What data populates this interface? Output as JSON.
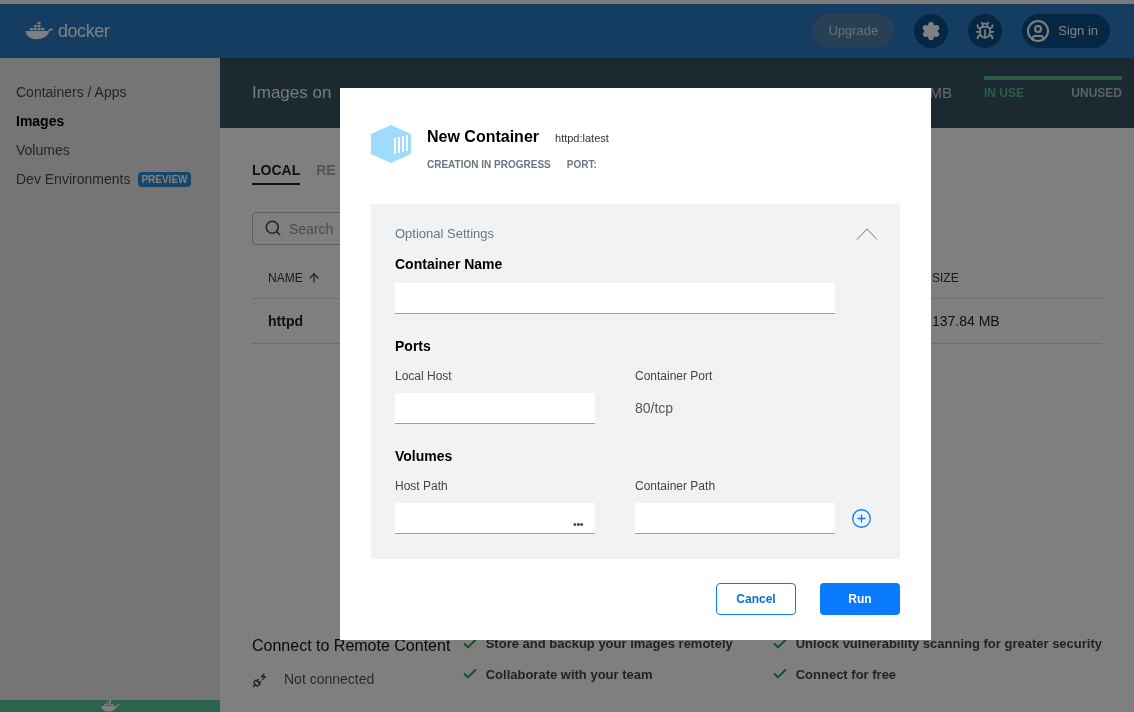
{
  "header": {
    "logo": "docker",
    "buttons": [
      {
        "kind": "upgrade",
        "label": "Upgrade"
      },
      {
        "kind": "settings"
      },
      {
        "kind": "troubleshoot"
      },
      {
        "kind": "signin",
        "label": "Sign in"
      }
    ]
  },
  "sidebar": {
    "items": [
      {
        "label": "Containers / Apps",
        "selected": false
      },
      {
        "label": "Images",
        "selected": true
      },
      {
        "label": "Volumes",
        "selected": false
      },
      {
        "label": "Dev Environments",
        "selected": false,
        "badge": "PREVIEW"
      }
    ]
  },
  "banner": {
    "title": "Images on",
    "size": "MB",
    "usage": {
      "level": 1,
      "in_use": "IN USE",
      "unused": "UNUSED"
    }
  },
  "tabs": [
    {
      "label": "LOCAL",
      "selected": true
    },
    {
      "label": "RE",
      "selected": false
    }
  ],
  "search": {
    "placeholder": "Search"
  },
  "table": {
    "columns": [
      {
        "label": "NAME",
        "sorted": true
      },
      {
        "label": "SIZE",
        "sorted": false
      }
    ],
    "rows": [
      {
        "name": "httpd",
        "size": "137.84 MB"
      }
    ]
  },
  "remote": {
    "title": "Connect to Remote Content",
    "status": "Not connected",
    "features": [
      [
        "Store and backup your images remotely",
        "Collaborate with your team"
      ],
      [
        "Unlock vulnerability scanning for greater security",
        "Connect for free"
      ]
    ]
  },
  "dialog": {
    "title": "New Container",
    "image": "httpd:latest",
    "status": "CREATION IN PROGRESS",
    "port": "PORT:",
    "settings": {
      "title": "Optional Settings",
      "expanded": true,
      "container_name": {
        "label": "Container Name"
      },
      "ports": {
        "title": "Ports",
        "local_host": "Local Host",
        "container_port": "Container Port",
        "port_value": "80/tcp"
      },
      "volumes": {
        "title": "Volumes",
        "host_path": "Host Path",
        "container_path": "Container Path",
        "browse": "•••"
      }
    },
    "buttons": [
      {
        "kind": "secondary",
        "label": "Cancel"
      },
      {
        "kind": "primary",
        "label": "Run"
      }
    ]
  }
}
